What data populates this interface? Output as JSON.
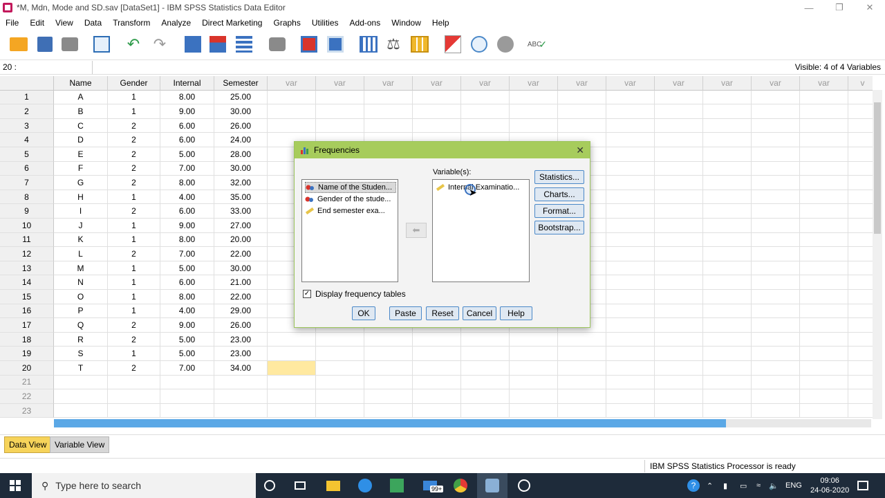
{
  "window": {
    "title": "*M, Mdn, Mode and SD.sav [DataSet1] - IBM SPSS Statistics Data Editor"
  },
  "menu": [
    "File",
    "Edit",
    "View",
    "Data",
    "Transform",
    "Analyze",
    "Direct Marketing",
    "Graphs",
    "Utilities",
    "Add-ons",
    "Window",
    "Help"
  ],
  "cell_editor": {
    "ref": "20 :",
    "visible": "Visible: 4 of 4 Variables"
  },
  "grid": {
    "columns": [
      "Name",
      "Gender",
      "Internal",
      "Semester",
      "var",
      "var",
      "var",
      "var",
      "var",
      "var",
      "var",
      "var",
      "var",
      "var",
      "var",
      "var",
      "v"
    ],
    "rows": [
      [
        "1",
        "A",
        "1",
        "8.00",
        "25.00"
      ],
      [
        "2",
        "B",
        "1",
        "9.00",
        "30.00"
      ],
      [
        "3",
        "C",
        "2",
        "6.00",
        "26.00"
      ],
      [
        "4",
        "D",
        "2",
        "6.00",
        "24.00"
      ],
      [
        "5",
        "E",
        "2",
        "5.00",
        "28.00"
      ],
      [
        "6",
        "F",
        "2",
        "7.00",
        "30.00"
      ],
      [
        "7",
        "G",
        "2",
        "8.00",
        "32.00"
      ],
      [
        "8",
        "H",
        "1",
        "4.00",
        "35.00"
      ],
      [
        "9",
        "I",
        "2",
        "6.00",
        "33.00"
      ],
      [
        "10",
        "J",
        "1",
        "9.00",
        "27.00"
      ],
      [
        "11",
        "K",
        "1",
        "8.00",
        "20.00"
      ],
      [
        "12",
        "L",
        "2",
        "7.00",
        "22.00"
      ],
      [
        "13",
        "M",
        "1",
        "5.00",
        "30.00"
      ],
      [
        "14",
        "N",
        "1",
        "6.00",
        "21.00"
      ],
      [
        "15",
        "O",
        "1",
        "8.00",
        "22.00"
      ],
      [
        "16",
        "P",
        "1",
        "4.00",
        "29.00"
      ],
      [
        "17",
        "Q",
        "2",
        "9.00",
        "26.00"
      ],
      [
        "18",
        "R",
        "2",
        "5.00",
        "23.00"
      ],
      [
        "19",
        "S",
        "1",
        "5.00",
        "23.00"
      ],
      [
        "20",
        "T",
        "2",
        "7.00",
        "34.00"
      ],
      [
        "21",
        "",
        "",
        "",
        ""
      ],
      [
        "22",
        "",
        "",
        "",
        ""
      ],
      [
        "23",
        "",
        "",
        "",
        ""
      ]
    ]
  },
  "tabs": {
    "data_view": "Data View",
    "variable_view": "Variable View"
  },
  "status": "IBM SPSS Statistics Processor is ready",
  "dialog": {
    "title": "Frequencies",
    "variables_label": "Variable(s):",
    "source_items": [
      "Name of the Studen...",
      "Gender of the stude...",
      "End semester exa..."
    ],
    "target_items": [
      "Internal Examinatio..."
    ],
    "side_buttons": [
      "Statistics...",
      "Charts...",
      "Format...",
      "Bootstrap..."
    ],
    "display_tables_label": "Display frequency tables",
    "display_tables_checked": true,
    "bottom_buttons": [
      "OK",
      "Paste",
      "Reset",
      "Cancel",
      "Help"
    ]
  },
  "taskbar": {
    "search_placeholder": "Type here to search",
    "badge": "99+",
    "lang": "ENG",
    "time": "09:06",
    "date": "24-06-2020"
  },
  "colors": {
    "dialog_title": "#a7cc5c",
    "active_tab": "#f6d35a",
    "selected_cell": "#ffe9a0",
    "taskbar": "#1e2b3a"
  }
}
